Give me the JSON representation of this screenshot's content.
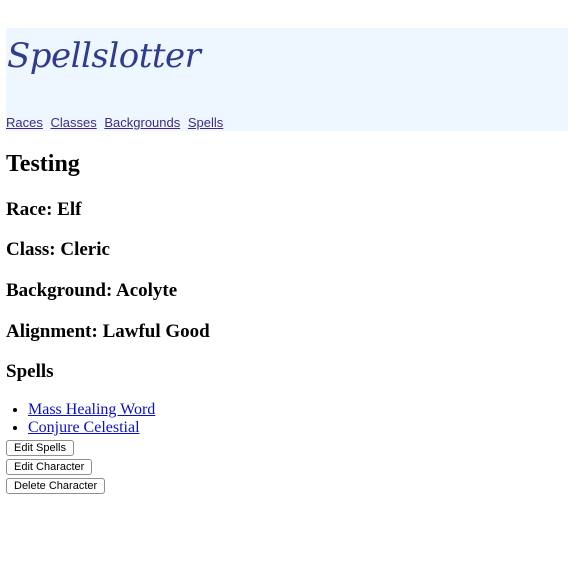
{
  "header": {
    "logo": "Spellslotter",
    "nav": [
      "Races",
      "Classes",
      "Backgrounds",
      "Spells"
    ]
  },
  "character": {
    "name": "Testing",
    "race_label": "Race:",
    "race": "Elf",
    "class_label": "Class:",
    "class": "Cleric",
    "background_label": "Background:",
    "background": "Acolyte",
    "alignment_label": "Alignment:",
    "alignment": "Lawful Good"
  },
  "spells": {
    "heading": "Spells",
    "items": [
      "Mass Healing Word",
      "Conjure Celestial"
    ]
  },
  "buttons": {
    "edit_spells": "Edit Spells",
    "edit_character": "Edit Character",
    "delete_character": "Delete Character"
  },
  "colors": {
    "header_bg": "#eef6ff",
    "logo": "#2e3b8e",
    "nav_link": "#3f2a85",
    "spell_link": "#0a10c8"
  }
}
